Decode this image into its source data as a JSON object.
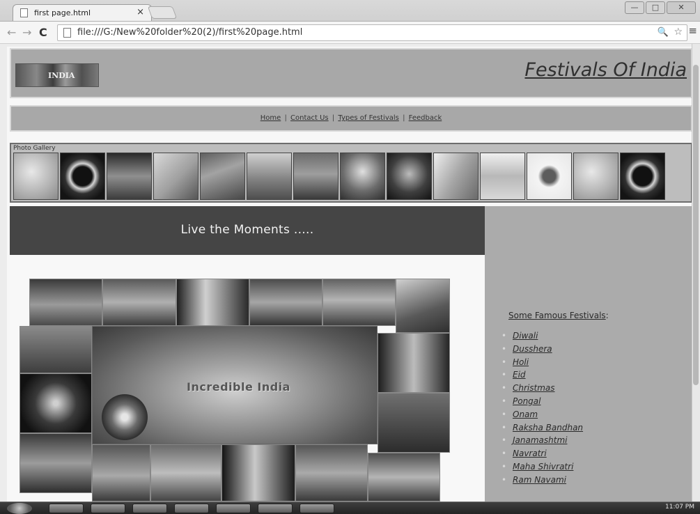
{
  "browser": {
    "tab_title": "first page.html",
    "tab_close": "×",
    "url": "file:///G:/New%20folder%20(2)/first%20page.html",
    "back": "←",
    "forward": "→",
    "reload": "C",
    "zoom": "🔍",
    "star": "☆",
    "menu": "≡",
    "minimize": "—",
    "maximize": "□",
    "close": "✕"
  },
  "header": {
    "logo_text": "INDIA",
    "site_title": "Festivals Of India"
  },
  "nav": {
    "home": "Home",
    "contact": "Contact Us",
    "types": "Types of Festivals",
    "feedback": "Feedback",
    "sep": "|"
  },
  "gallery": {
    "label": "Photo Gallery"
  },
  "banner": {
    "text": "Live the Moments ....."
  },
  "collage": {
    "caption": "Incredible India"
  },
  "sidebar": {
    "title": "Some Famous Festivals",
    "title_suffix": ":",
    "items": [
      "Diwali",
      "Dusshera",
      "Holi",
      "Eid",
      "Christmas",
      "Pongal",
      "Onam",
      "Raksha Bandhan",
      "Janamashtmi",
      "Navratri",
      "Maha Shivratri",
      "Ram Navami"
    ]
  },
  "taskbar": {
    "clock": "11:07 PM"
  }
}
